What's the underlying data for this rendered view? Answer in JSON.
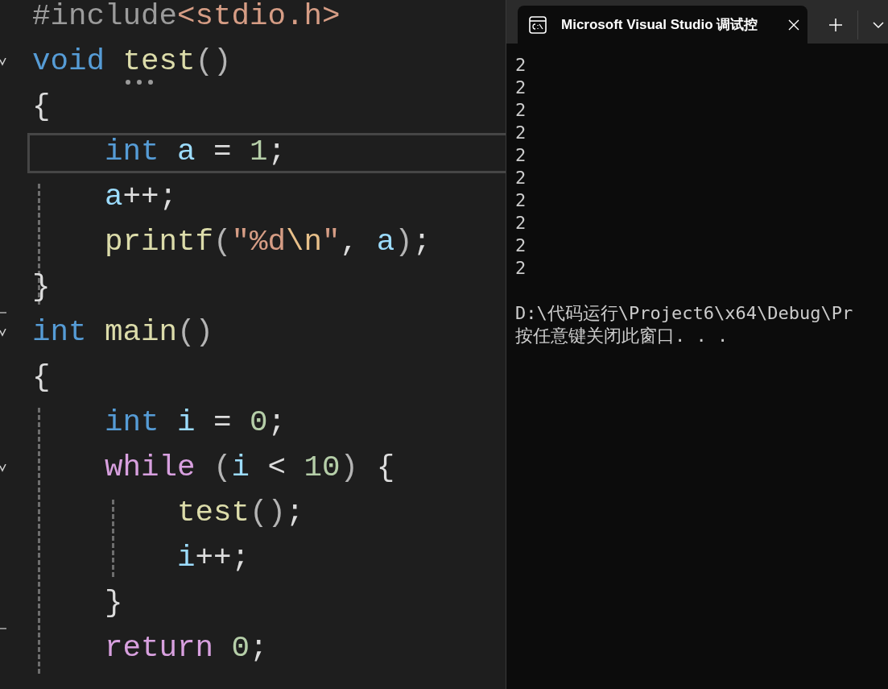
{
  "editor": {
    "lines": [
      {
        "fold_start": false,
        "fold_end": false,
        "current": false,
        "tokens": [
          {
            "text": "#include",
            "kind": "preproc"
          },
          {
            "text": "<stdio.h>",
            "kind": "string"
          }
        ]
      },
      {
        "fold_start": true,
        "fold_end": false,
        "current": false,
        "tokens": [
          {
            "text": "void ",
            "kind": "keyword"
          },
          {
            "text": "test",
            "kind": "function"
          },
          {
            "text": "()",
            "kind": "paren"
          }
        ]
      },
      {
        "fold_start": false,
        "fold_end": false,
        "current": false,
        "tokens": [
          {
            "text": "{",
            "kind": "punct"
          }
        ]
      },
      {
        "fold_start": false,
        "fold_end": false,
        "current": true,
        "tokens": [
          {
            "text": "    int ",
            "kind": "keyword"
          },
          {
            "text": "a",
            "kind": "variable"
          },
          {
            "text": " = ",
            "kind": "punct"
          },
          {
            "text": "1",
            "kind": "number"
          },
          {
            "text": ";",
            "kind": "punct"
          }
        ]
      },
      {
        "fold_start": false,
        "fold_end": false,
        "current": false,
        "tokens": [
          {
            "text": "    a",
            "kind": "variable"
          },
          {
            "text": "++;",
            "kind": "punct"
          }
        ]
      },
      {
        "fold_start": false,
        "fold_end": false,
        "current": false,
        "tokens": [
          {
            "text": "    printf",
            "kind": "function"
          },
          {
            "text": "(",
            "kind": "paren"
          },
          {
            "text": "\"%d",
            "kind": "string"
          },
          {
            "text": "\\n",
            "kind": "escape"
          },
          {
            "text": "\"",
            "kind": "string"
          },
          {
            "text": ", ",
            "kind": "punct"
          },
          {
            "text": "a",
            "kind": "variable"
          },
          {
            "text": ")",
            "kind": "paren"
          },
          {
            "text": ";",
            "kind": "punct"
          }
        ]
      },
      {
        "fold_start": false,
        "fold_end": true,
        "current": false,
        "tokens": [
          {
            "text": "}",
            "kind": "punct"
          }
        ]
      },
      {
        "fold_start": true,
        "fold_end": false,
        "current": false,
        "tokens": [
          {
            "text": "int ",
            "kind": "keyword"
          },
          {
            "text": "main",
            "kind": "function"
          },
          {
            "text": "()",
            "kind": "paren"
          }
        ]
      },
      {
        "fold_start": false,
        "fold_end": false,
        "current": false,
        "tokens": [
          {
            "text": "{",
            "kind": "punct"
          }
        ]
      },
      {
        "fold_start": false,
        "fold_end": false,
        "current": false,
        "tokens": [
          {
            "text": "    int ",
            "kind": "keyword"
          },
          {
            "text": "i",
            "kind": "variable"
          },
          {
            "text": " = ",
            "kind": "punct"
          },
          {
            "text": "0",
            "kind": "number"
          },
          {
            "text": ";",
            "kind": "punct"
          }
        ]
      },
      {
        "fold_start": true,
        "fold_end": false,
        "current": false,
        "tokens": [
          {
            "text": "    while ",
            "kind": "control"
          },
          {
            "text": "(",
            "kind": "paren"
          },
          {
            "text": "i",
            "kind": "variable"
          },
          {
            "text": " < ",
            "kind": "punct"
          },
          {
            "text": "10",
            "kind": "number"
          },
          {
            "text": ")",
            "kind": "paren"
          },
          {
            "text": " {",
            "kind": "punct"
          }
        ]
      },
      {
        "fold_start": false,
        "fold_end": false,
        "current": false,
        "tokens": [
          {
            "text": "        test",
            "kind": "function"
          },
          {
            "text": "()",
            "kind": "paren"
          },
          {
            "text": ";",
            "kind": "punct"
          }
        ]
      },
      {
        "fold_start": false,
        "fold_end": false,
        "current": false,
        "tokens": [
          {
            "text": "        i",
            "kind": "variable"
          },
          {
            "text": "++;",
            "kind": "punct"
          }
        ]
      },
      {
        "fold_start": false,
        "fold_end": true,
        "current": false,
        "tokens": [
          {
            "text": "    }",
            "kind": "punct"
          }
        ]
      },
      {
        "fold_start": false,
        "fold_end": false,
        "current": false,
        "tokens": [
          {
            "text": "    return ",
            "kind": "control"
          },
          {
            "text": "0",
            "kind": "number"
          },
          {
            "text": ";",
            "kind": "punct"
          }
        ]
      }
    ]
  },
  "terminal": {
    "tab": {
      "title": "Microsoft Visual Studio 调试控",
      "selected": true
    },
    "output": [
      "2",
      "2",
      "2",
      "2",
      "2",
      "2",
      "2",
      "2",
      "2",
      "2"
    ],
    "messages": [
      "D:\\代码运行\\Project6\\x64\\Debug\\Pr",
      "按任意键关闭此窗口. . ."
    ]
  }
}
